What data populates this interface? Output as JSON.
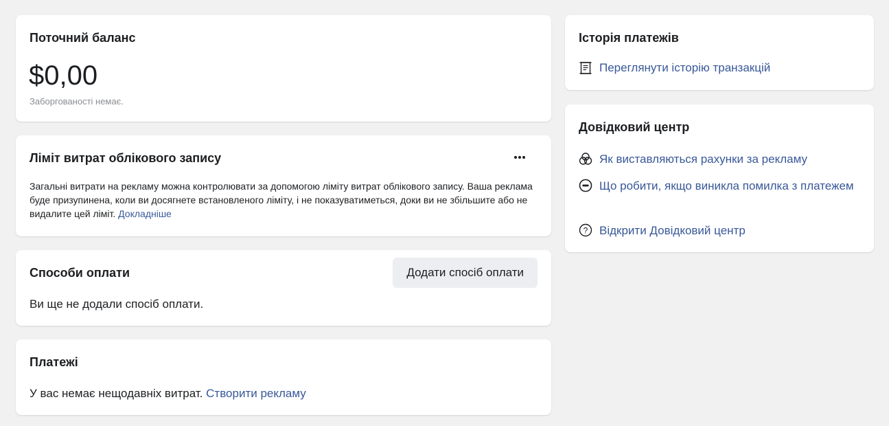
{
  "balance": {
    "title": "Поточний баланс",
    "amount": "$0,00",
    "subtitle": "Заборгованості немає."
  },
  "limit": {
    "title": "Ліміт витрат облікового запису",
    "more_icon": "more-horizontal-icon",
    "description": "Загальні витрати на рекламу можна контролювати за допомогою ліміту витрат облікового запису. Ваша реклама буде призупинена, коли ви досягнете встановленого ліміту, і не показуватиметься, доки ви не збільшите або не видалите цей ліміт.",
    "learn_more": "Докладніше"
  },
  "methods": {
    "title": "Способи оплати",
    "add_button": "Додати спосіб оплати",
    "empty_text": "Ви ще не додали спосіб оплати."
  },
  "payments": {
    "title": "Платежі",
    "text": "У вас немає нещодавніх витрат.",
    "create_link": "Створити рекламу"
  },
  "history": {
    "title": "Історія платежів",
    "link": "Переглянути історію транзакцій",
    "icon": "receipt-icon"
  },
  "help": {
    "title": "Довідковий центр",
    "items": [
      {
        "label": "Як виставляються рахунки за рекламу",
        "icon": "billing-circles-icon"
      },
      {
        "label": "Що робити, якщо виникла помилка з платежем",
        "icon": "minus-circle-icon"
      },
      {
        "label": "Відкрити Довідковий центр",
        "icon": "question-circle-icon"
      }
    ]
  },
  "colors": {
    "link": "#385898",
    "background": "#f1f1f1",
    "button_bg": "#eceef1",
    "muted_text": "#8a8d91"
  }
}
